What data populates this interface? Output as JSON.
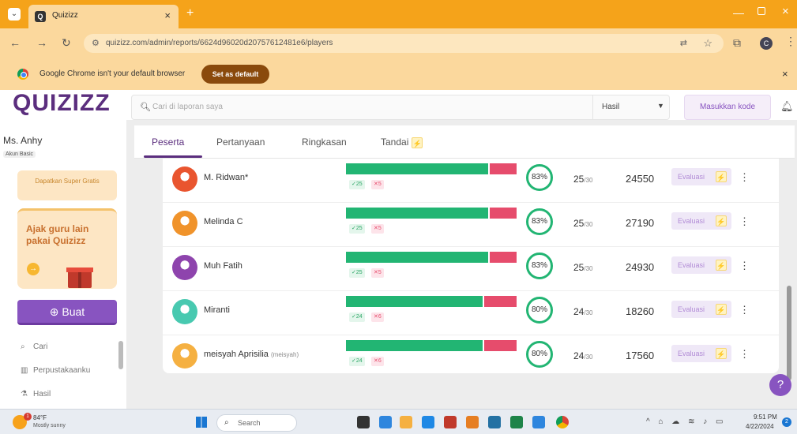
{
  "browser": {
    "tab_title": "Quizizz",
    "new_tab": "+",
    "url": "quizizz.com/admin/reports/6624d96020d20757612481e6/players",
    "infobar_text": "Google Chrome isn't your default browser",
    "set_default_label": "Set as default",
    "close": "×"
  },
  "header": {
    "logo": "QUIZIZZ",
    "search_placeholder": "Cari di laporan saya",
    "search_scope": "Hasil",
    "join_label": "Masukkan kode"
  },
  "sidebar": {
    "user_name": "Ms. Anhy",
    "plan": "Akun Basic",
    "super_label": "Dapatkan Super Gratis",
    "invite_text": "Ajak guru lain pakai Quizizz",
    "create_label": "⊕ Buat",
    "items": [
      {
        "icon": "⌕",
        "label": "Cari"
      },
      {
        "icon": "▥",
        "label": "Perpustakaanku"
      },
      {
        "icon": "⚗",
        "label": "Hasil"
      }
    ]
  },
  "tabs": [
    {
      "label": "Peserta"
    },
    {
      "label": "Pertanyaan"
    },
    {
      "label": "Ringkasan"
    },
    {
      "label": "Tandai"
    }
  ],
  "eval_label": "Evaluasi",
  "players": [
    {
      "name": "M. Ridwan*",
      "sub": "",
      "correct": 25,
      "wrong": 5,
      "correct_label": "✓25",
      "wrong_label": "✕5",
      "accuracy": "83%",
      "score_num": "25",
      "score_den": "/30",
      "points": "24550",
      "avatar_color": "#e9552f"
    },
    {
      "name": "Melinda C",
      "sub": "",
      "correct": 25,
      "wrong": 5,
      "correct_label": "✓25",
      "wrong_label": "✕5",
      "accuracy": "83%",
      "score_num": "25",
      "score_den": "/30",
      "points": "27190",
      "avatar_color": "#f0932b"
    },
    {
      "name": "Muh Fatih",
      "sub": "",
      "correct": 25,
      "wrong": 5,
      "correct_label": "✓25",
      "wrong_label": "✕5",
      "accuracy": "83%",
      "score_num": "25",
      "score_den": "/30",
      "points": "24930",
      "avatar_color": "#8e44ad"
    },
    {
      "name": "Miranti",
      "sub": "",
      "correct": 24,
      "wrong": 6,
      "correct_label": "✓24",
      "wrong_label": "✕6",
      "accuracy": "80%",
      "score_num": "24",
      "score_den": "/30",
      "points": "18260",
      "avatar_color": "#48c9b0"
    },
    {
      "name": "meisyah Aprisilia",
      "sub": "(meisyah)",
      "correct": 24,
      "wrong": 6,
      "correct_label": "✓24",
      "wrong_label": "✕6",
      "accuracy": "80%",
      "score_num": "24",
      "score_den": "/30",
      "points": "17560",
      "avatar_color": "#f5b041"
    }
  ],
  "help": "?",
  "taskbar": {
    "temp": "84°F",
    "weather": "Mostly sunny",
    "search": "Search",
    "time": "9:51 PM",
    "date": "4/22/2024"
  },
  "colors": {
    "brand": "#5b2e7e",
    "accent": "#8854c0",
    "correct": "#22b573",
    "wrong": "#e64c6c",
    "titlebar": "#f5a31a"
  }
}
